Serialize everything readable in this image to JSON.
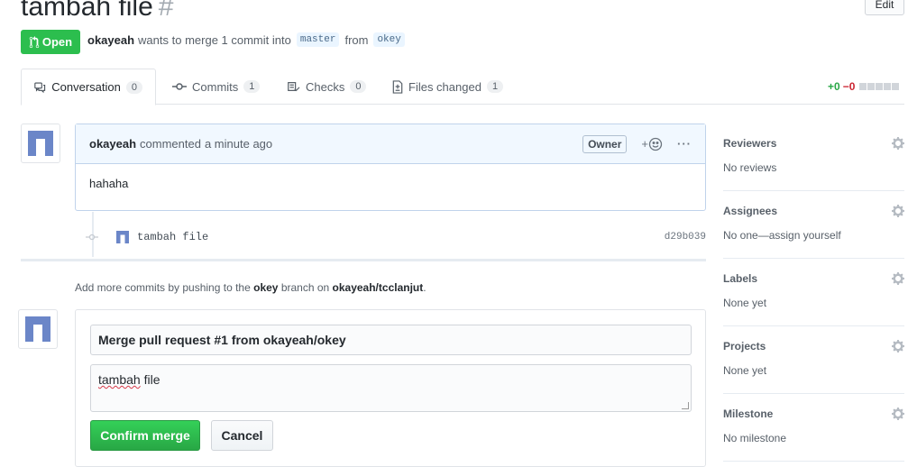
{
  "header": {
    "title": "tambah file",
    "number": "#",
    "edit_label": "Edit"
  },
  "pr_state": {
    "label": "Open",
    "author": "okayeah",
    "text_mid": "wants to merge 1 commit into",
    "base_branch": "master",
    "text_from": "from",
    "head_branch": "okey"
  },
  "tabs": [
    {
      "label": "Conversation",
      "count": "0"
    },
    {
      "label": "Commits",
      "count": "1"
    },
    {
      "label": "Checks",
      "count": "0"
    },
    {
      "label": "Files changed",
      "count": "1"
    }
  ],
  "diffstat": {
    "additions": "+0",
    "deletions": "−0"
  },
  "comment": {
    "author": "okayeah",
    "action": "commented",
    "time": "a minute ago",
    "badge": "Owner",
    "reaction": "+",
    "body": "hahaha"
  },
  "commit": {
    "message": "tambah file",
    "sha": "d29b039"
  },
  "push_hint": {
    "pre": "Add more commits by pushing to the",
    "branch": "okey",
    "mid": "branch on",
    "repo": "okayeah/tcclanjut",
    "post": "."
  },
  "merge_form": {
    "title_value": "Merge pull request #1 from okayeah/okey",
    "desc_word_1": "tambah",
    "desc_word_2": " file",
    "confirm_label": "Confirm merge",
    "cancel_label": "Cancel"
  },
  "sidebar": [
    {
      "heading": "Reviewers",
      "value": "No reviews"
    },
    {
      "heading": "Assignees",
      "value": "No one—assign yourself"
    },
    {
      "heading": "Labels",
      "value": "None yet"
    },
    {
      "heading": "Projects",
      "value": "None yet"
    },
    {
      "heading": "Milestone",
      "value": "No milestone"
    }
  ],
  "colors": {
    "open_green": "#2cbe4e",
    "link_blue": "#0366d6",
    "avatar_blue": "#6b86c8"
  },
  "icons": [
    "git-pull-request-icon",
    "comment-discussion-icon",
    "git-commit-icon",
    "checklist-icon",
    "file-diff-icon",
    "smiley-icon",
    "kebab-horizontal-icon",
    "gear-icon"
  ]
}
